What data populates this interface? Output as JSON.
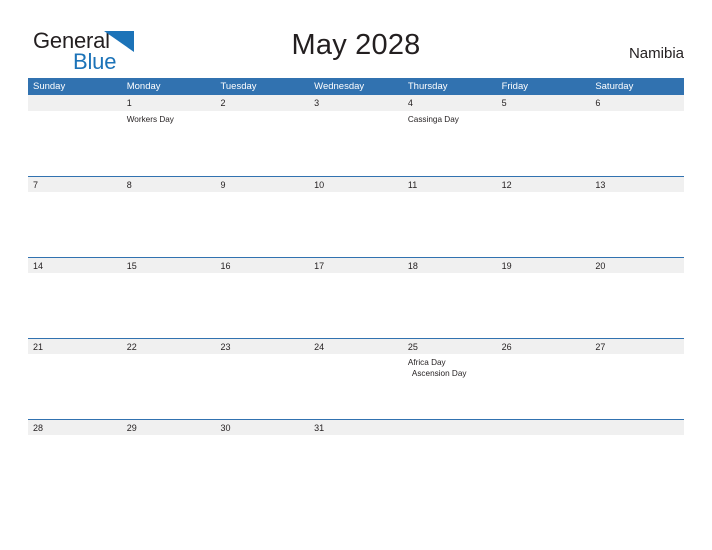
{
  "logo": {
    "word1": "General",
    "word2": "Blue",
    "triangle_color": "#1c73b8",
    "text_color": "#231f20"
  },
  "header": {
    "title": "May 2028",
    "country": "Namibia",
    "accent_color": "#3172b0",
    "date_band_color": "#f0f0f0"
  },
  "calendar": {
    "day_headers": [
      "Sunday",
      "Monday",
      "Tuesday",
      "Wednesday",
      "Thursday",
      "Friday",
      "Saturday"
    ],
    "weeks": [
      {
        "days": [
          {
            "date": "",
            "events": []
          },
          {
            "date": "1",
            "events": [
              {
                "label": "Workers Day",
                "indent": false
              }
            ]
          },
          {
            "date": "2",
            "events": []
          },
          {
            "date": "3",
            "events": []
          },
          {
            "date": "4",
            "events": [
              {
                "label": "Cassinga Day",
                "indent": false
              }
            ]
          },
          {
            "date": "5",
            "events": []
          },
          {
            "date": "6",
            "events": []
          }
        ]
      },
      {
        "days": [
          {
            "date": "7",
            "events": []
          },
          {
            "date": "8",
            "events": []
          },
          {
            "date": "9",
            "events": []
          },
          {
            "date": "10",
            "events": []
          },
          {
            "date": "11",
            "events": []
          },
          {
            "date": "12",
            "events": []
          },
          {
            "date": "13",
            "events": []
          }
        ]
      },
      {
        "days": [
          {
            "date": "14",
            "events": []
          },
          {
            "date": "15",
            "events": []
          },
          {
            "date": "16",
            "events": []
          },
          {
            "date": "17",
            "events": []
          },
          {
            "date": "18",
            "events": []
          },
          {
            "date": "19",
            "events": []
          },
          {
            "date": "20",
            "events": []
          }
        ]
      },
      {
        "days": [
          {
            "date": "21",
            "events": []
          },
          {
            "date": "22",
            "events": []
          },
          {
            "date": "23",
            "events": []
          },
          {
            "date": "24",
            "events": []
          },
          {
            "date": "25",
            "events": [
              {
                "label": "Africa Day",
                "indent": false
              },
              {
                "label": "Ascension Day",
                "indent": true
              }
            ]
          },
          {
            "date": "26",
            "events": []
          },
          {
            "date": "27",
            "events": []
          }
        ]
      },
      {
        "days": [
          {
            "date": "28",
            "events": []
          },
          {
            "date": "29",
            "events": []
          },
          {
            "date": "30",
            "events": []
          },
          {
            "date": "31",
            "events": []
          },
          {
            "date": "",
            "events": []
          },
          {
            "date": "",
            "events": []
          },
          {
            "date": "",
            "events": []
          }
        ]
      }
    ]
  }
}
